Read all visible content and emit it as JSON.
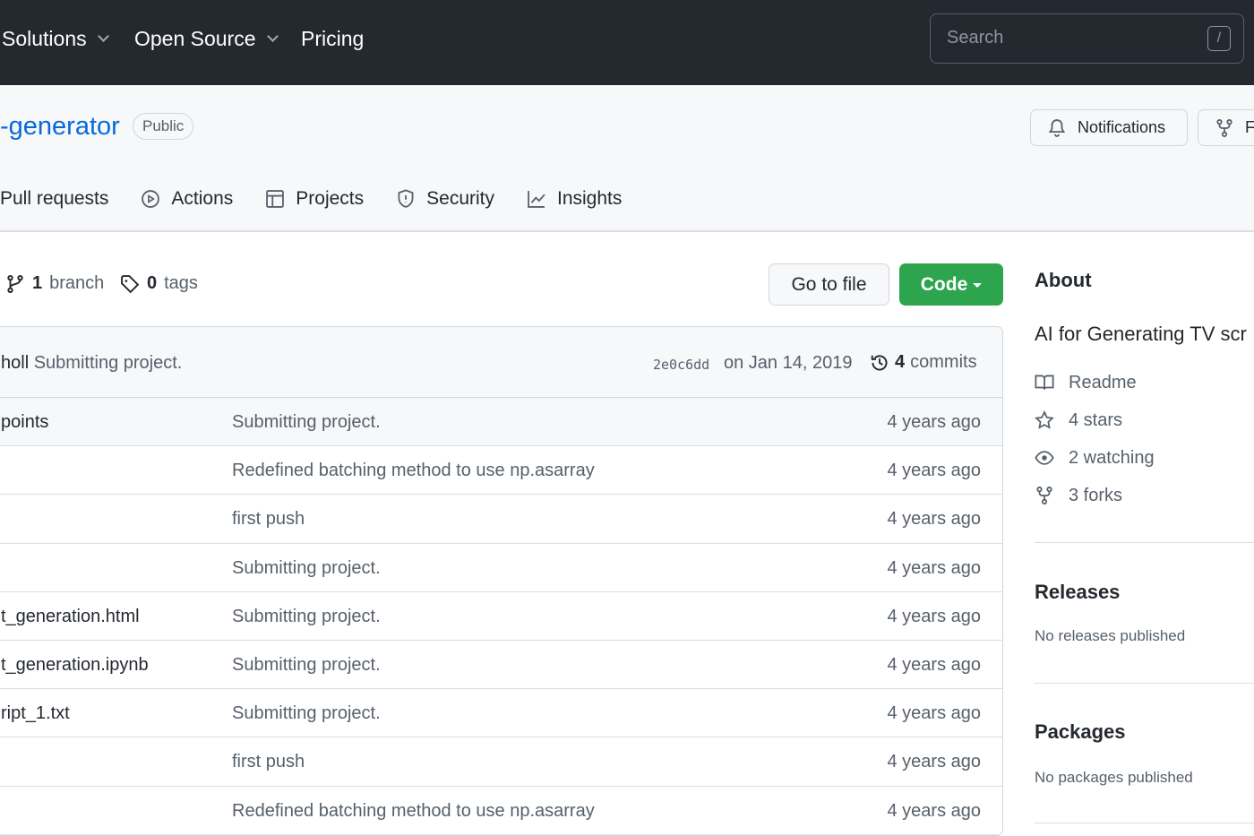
{
  "topnav": {
    "items": [
      {
        "label": "Solutions",
        "dropdown": true
      },
      {
        "label": "Open Source",
        "dropdown": true
      },
      {
        "label": "Pricing",
        "dropdown": false
      }
    ],
    "search_placeholder": "Search",
    "search_shortcut": "/"
  },
  "repo": {
    "name": "-generator",
    "visibility": "Public",
    "notifications_label": "Notifications",
    "fork_label": "F"
  },
  "tabs": [
    {
      "label": "Pull requests",
      "icon": "pull-request-icon"
    },
    {
      "label": "Actions",
      "icon": "play-icon"
    },
    {
      "label": "Projects",
      "icon": "table-icon"
    },
    {
      "label": "Security",
      "icon": "shield-icon"
    },
    {
      "label": "Insights",
      "icon": "graph-icon"
    }
  ],
  "branches": {
    "count": "1",
    "label": "branch"
  },
  "tags": {
    "count": "0",
    "label": "tags"
  },
  "go_to_file": "Go to file",
  "code_button": "Code",
  "colors": {
    "header": "#24292f",
    "code_button": "#2da44e",
    "link": "#0969da"
  },
  "latest_commit": {
    "author": "holl",
    "message": "Submitting project.",
    "sha": "2e0c6dd",
    "date": "on Jan 14, 2019",
    "commits_count": "4",
    "commits_label": "commits"
  },
  "files": [
    {
      "name": "points",
      "message": "Submitting project.",
      "age": "4 years ago"
    },
    {
      "name": "",
      "message": "Redefined batching method to use np.asarray",
      "age": "4 years ago"
    },
    {
      "name": "",
      "message": "first push",
      "age": "4 years ago"
    },
    {
      "name": "",
      "message": "Submitting project.",
      "age": "4 years ago"
    },
    {
      "name": "t_generation.html",
      "message": "Submitting project.",
      "age": "4 years ago"
    },
    {
      "name": "t_generation.ipynb",
      "message": "Submitting project.",
      "age": "4 years ago"
    },
    {
      "name": "ript_1.txt",
      "message": "Submitting project.",
      "age": "4 years ago"
    },
    {
      "name": "",
      "message": "first push",
      "age": "4 years ago"
    },
    {
      "name": "",
      "message": "Redefined batching method to use np.asarray",
      "age": "4 years ago"
    }
  ],
  "about": {
    "title": "About",
    "description": "AI for Generating TV scr",
    "readme": "Readme",
    "stars": "4 stars",
    "watching": "2 watching",
    "forks": "3 forks"
  },
  "releases": {
    "title": "Releases",
    "text": "No releases published"
  },
  "packages": {
    "title": "Packages",
    "text": "No packages published"
  }
}
